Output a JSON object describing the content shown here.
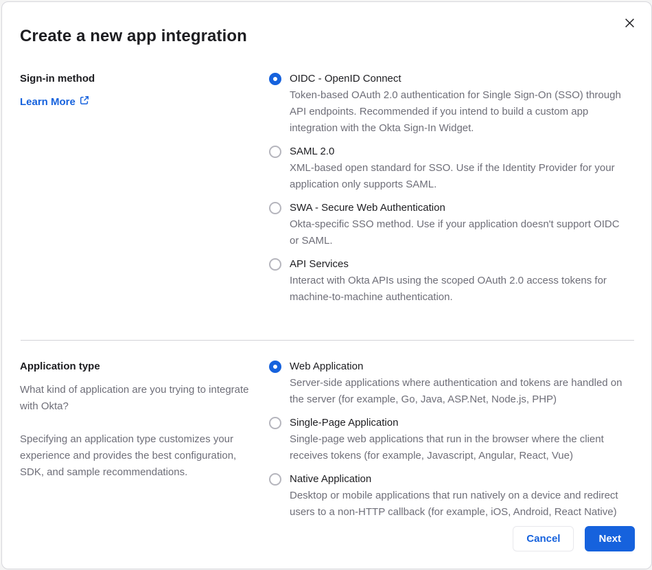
{
  "dialog": {
    "title": "Create a new app integration"
  },
  "signin_section": {
    "label": "Sign-in method",
    "learn_more_label": "Learn More",
    "options": [
      {
        "label": "OIDC - OpenID Connect",
        "description": "Token-based OAuth 2.0 authentication for Single Sign-On (SSO) through API endpoints. Recommended if you intend to build a custom app integration with the Okta Sign-In Widget.",
        "selected": true
      },
      {
        "label": "SAML 2.0",
        "description": "XML-based open standard for SSO. Use if the Identity Provider for your application only supports SAML.",
        "selected": false
      },
      {
        "label": "SWA - Secure Web Authentication",
        "description": "Okta-specific SSO method. Use if your application doesn't support OIDC or SAML.",
        "selected": false
      },
      {
        "label": "API Services",
        "description": "Interact with Okta APIs using the scoped OAuth 2.0 access tokens for machine-to-machine authentication.",
        "selected": false
      }
    ]
  },
  "apptype_section": {
    "label": "Application type",
    "description_1": "What kind of application are you trying to integrate with Okta?",
    "description_2": "Specifying an application type customizes your experience and provides the best configuration, SDK, and sample recommendations.",
    "options": [
      {
        "label": "Web Application",
        "description": "Server-side applications where authentication and tokens are handled on the server (for example, Go, Java, ASP.Net, Node.js, PHP)",
        "selected": true
      },
      {
        "label": "Single-Page Application",
        "description": "Single-page web applications that run in the browser where the client receives tokens (for example, Javascript, Angular, React, Vue)",
        "selected": false
      },
      {
        "label": "Native Application",
        "description": "Desktop or mobile applications that run natively on a device and redirect users to a non-HTTP callback (for example, iOS, Android, React Native)",
        "selected": false
      }
    ]
  },
  "footer": {
    "cancel_label": "Cancel",
    "next_label": "Next"
  },
  "colors": {
    "primary_blue": "#1662dd",
    "text_dark": "#1d1d21",
    "text_gray": "#6e6e78",
    "border_gray": "#d7d7dc"
  }
}
